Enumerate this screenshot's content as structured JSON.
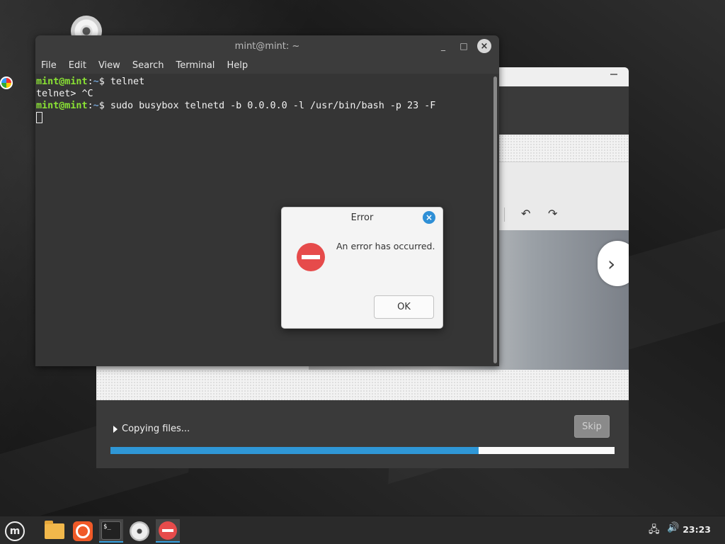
{
  "terminal": {
    "title": "mint@mint: ~",
    "menu": [
      "File",
      "Edit",
      "View",
      "Search",
      "Terminal",
      "Help"
    ],
    "lines": [
      {
        "prompt_user": "mint@mint",
        "prompt_path": "~",
        "command": "telnet"
      },
      {
        "plain": "telnet> ^C"
      },
      {
        "prompt_user": "mint@mint",
        "prompt_path": "~",
        "command": "sudo busybox telnetd -b 0.0.0.0 -l /usr/bin/bash -p 23 -F"
      }
    ],
    "minimize": "_",
    "maximize": "□",
    "close": "×"
  },
  "dialog": {
    "title": "Error",
    "message": "An error has occurred.",
    "ok_label": "OK",
    "close": "×"
  },
  "installer": {
    "status": "Copying files...",
    "skip_label": "Skip",
    "progress": 0.73,
    "next_glyph": "›",
    "undo_glyph": "↶",
    "redo_glyph": "↷"
  },
  "taskbar": {
    "term_glyph": "$_",
    "mint_glyph": "m",
    "network_glyph": "🖧",
    "volume_glyph": "🔊",
    "clock": "23:23"
  },
  "colors": {
    "accent": "#2f97d6",
    "prompt_green": "#8ae234",
    "prompt_blue": "#729fcf",
    "error_red": "#e64b4b"
  }
}
